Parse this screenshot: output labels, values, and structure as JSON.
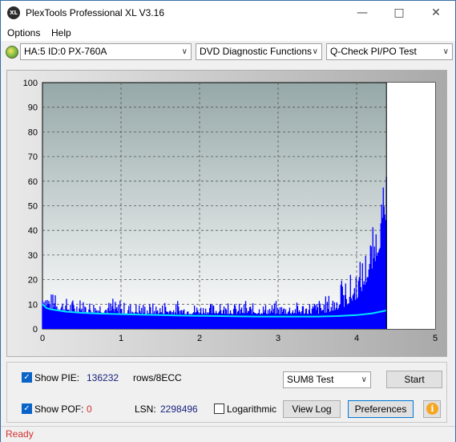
{
  "window": {
    "title": "PlexTools Professional XL V3.16",
    "icon_text": "XL",
    "minimize_icon": "minimize-icon",
    "maximize_icon": "maximize-icon",
    "close_icon": "close-icon"
  },
  "menu": {
    "options": "Options",
    "help": "Help"
  },
  "toolbar": {
    "drive": "HA:5 ID:0  PX-760A",
    "function": "DVD Diagnostic Functions",
    "test": "Q-Check PI/PO Test"
  },
  "chart_data": {
    "type": "area",
    "xlim": [
      0,
      5
    ],
    "ylim": [
      0,
      100
    ],
    "x_ticks": [
      "0",
      "1",
      "2",
      "3",
      "4",
      "5"
    ],
    "y_ticks": [
      "0",
      "10",
      "20",
      "30",
      "40",
      "50",
      "60",
      "70",
      "80",
      "90",
      "100"
    ],
    "grid": true,
    "data_end_x": 4.38,
    "pie_peaks": {
      "x": [
        0.0,
        0.1,
        0.25,
        0.5,
        0.75,
        1.0,
        1.25,
        1.5,
        1.75,
        2.0,
        2.25,
        2.5,
        2.75,
        3.0,
        3.25,
        3.5,
        3.7,
        3.85,
        4.0,
        4.1,
        4.2,
        4.3,
        4.35,
        4.38
      ],
      "y": [
        18,
        15,
        13,
        12,
        12,
        11,
        11,
        10.5,
        10.5,
        10.5,
        10.5,
        10.5,
        10.5,
        10.5,
        11,
        12,
        15,
        20,
        26,
        32,
        41,
        52,
        60,
        62
      ]
    },
    "pie_base": {
      "x": [
        0.0,
        0.1,
        0.25,
        0.5,
        0.75,
        1.0,
        1.25,
        1.5,
        1.75,
        2.0,
        2.25,
        2.5,
        2.75,
        3.0,
        3.25,
        3.5,
        3.7,
        3.85,
        4.0,
        4.1,
        4.2,
        4.3,
        4.35,
        4.38
      ],
      "y": [
        10,
        8,
        7,
        6.5,
        6.5,
        6,
        6,
        6,
        6,
        6,
        6,
        6,
        6,
        6,
        6,
        6,
        7,
        9,
        12,
        17,
        24,
        33,
        40,
        45
      ]
    },
    "pif_line": {
      "x": [
        0.0,
        0.05,
        0.1,
        0.2,
        0.3,
        0.5,
        0.75,
        1.0,
        1.25,
        1.5,
        1.75,
        2.0,
        2.25,
        2.5,
        2.75,
        3.0,
        3.25,
        3.5,
        3.75,
        4.0,
        4.2,
        4.38
      ],
      "y": [
        10,
        8.5,
        8,
        7.5,
        7,
        6.5,
        6.2,
        6,
        5.8,
        5.6,
        5.4,
        5.3,
        5.2,
        5.1,
        5,
        5,
        5,
        5,
        5.2,
        5.6,
        6.3,
        7.5
      ]
    },
    "colors": {
      "pie": "#0000ff",
      "pif": "#00e5ff",
      "plot_top": "#96a8a8",
      "plot_bottom": "#ffffff"
    }
  },
  "controls": {
    "show_pie_label": "Show PIE:",
    "pie_value": "136232",
    "pie_unit": "rows/8ECC",
    "show_pof_label": "Show POF:",
    "pof_value": "0",
    "lsn_label": "LSN:",
    "lsn_value": "2298496",
    "logarithmic_label": "Logarithmic",
    "test_mode": "SUM8 Test",
    "start": "Start",
    "view_log": "View Log",
    "preferences": "Preferences"
  },
  "status": {
    "text": "Ready"
  }
}
